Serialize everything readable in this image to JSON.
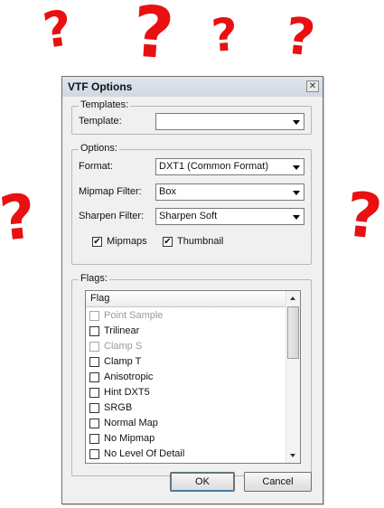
{
  "annotations": {
    "question_mark": "?"
  },
  "dialog": {
    "title": "VTF Options",
    "close_glyph": "✕",
    "templates": {
      "group_label": "Templates:",
      "template_label": "Template:",
      "template_value": ""
    },
    "options": {
      "group_label": "Options:",
      "format_label": "Format:",
      "format_value": "DXT1 (Common Format)",
      "mipmap_filter_label": "Mipmap Filter:",
      "mipmap_filter_value": "Box",
      "sharpen_filter_label": "Sharpen Filter:",
      "sharpen_filter_value": "Sharpen Soft",
      "mipmaps_label": "Mipmaps",
      "mipmaps_checked": true,
      "thumbnail_label": "Thumbnail",
      "thumbnail_checked": true
    },
    "flags": {
      "group_label": "Flags:",
      "column_header": "Flag",
      "items": [
        {
          "label": "Point Sample",
          "checked": false,
          "disabled": true
        },
        {
          "label": "Trilinear",
          "checked": false,
          "disabled": false
        },
        {
          "label": "Clamp S",
          "checked": false,
          "disabled": true
        },
        {
          "label": "Clamp T",
          "checked": false,
          "disabled": false
        },
        {
          "label": "Anisotropic",
          "checked": false,
          "disabled": false
        },
        {
          "label": "Hint DXT5",
          "checked": false,
          "disabled": false
        },
        {
          "label": "SRGB",
          "checked": false,
          "disabled": false
        },
        {
          "label": "Normal Map",
          "checked": false,
          "disabled": false
        },
        {
          "label": "No Mipmap",
          "checked": false,
          "disabled": false
        },
        {
          "label": "No Level Of Detail",
          "checked": false,
          "disabled": false
        }
      ]
    },
    "ok_label": "OK",
    "cancel_label": "Cancel"
  },
  "colors": {
    "annotation_red": "#e81010",
    "dialog_bg": "#f0f0f0"
  }
}
